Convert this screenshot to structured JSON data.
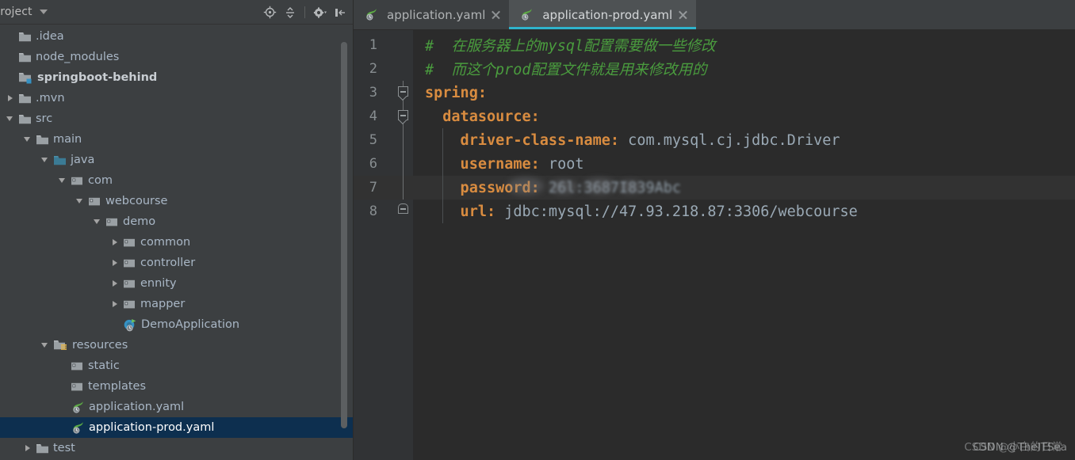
{
  "project_panel": {
    "title": "Project",
    "title_caret_icon": "chevron-down-icon",
    "tools": [
      {
        "name": "locate-in-tree-icon",
        "tooltip": "Select Opened File"
      },
      {
        "name": "collapse-all-icon",
        "tooltip": "Collapse All"
      },
      {
        "name": "settings-gear-icon",
        "tooltip": "Show Options Menu"
      },
      {
        "name": "hide-panel-icon",
        "tooltip": "Hide"
      }
    ],
    "tree": [
      {
        "label": ".idea",
        "indent": 0,
        "twisty": "none",
        "icon": "folder-icon",
        "selected": false,
        "bold": false
      },
      {
        "label": "node_modules",
        "indent": 0,
        "twisty": "none",
        "icon": "folder-icon",
        "selected": false,
        "bold": false
      },
      {
        "label": "springboot-behind",
        "indent": 0,
        "twisty": "none",
        "icon": "module-folder-icon",
        "selected": false,
        "bold": true
      },
      {
        "label": ".mvn",
        "indent": 0,
        "twisty": "collapsed",
        "icon": "folder-icon",
        "selected": false,
        "bold": false
      },
      {
        "label": "src",
        "indent": 0,
        "twisty": "expanded",
        "icon": "folder-icon",
        "selected": false,
        "bold": false
      },
      {
        "label": "main",
        "indent": 1,
        "twisty": "expanded",
        "icon": "folder-icon",
        "selected": false,
        "bold": false
      },
      {
        "label": "java",
        "indent": 2,
        "twisty": "expanded",
        "icon": "source-root-icon",
        "selected": false,
        "bold": false
      },
      {
        "label": "com",
        "indent": 3,
        "twisty": "expanded",
        "icon": "package-icon",
        "selected": false,
        "bold": false
      },
      {
        "label": "webcourse",
        "indent": 4,
        "twisty": "expanded",
        "icon": "package-icon",
        "selected": false,
        "bold": false
      },
      {
        "label": "demo",
        "indent": 5,
        "twisty": "expanded",
        "icon": "package-icon",
        "selected": false,
        "bold": false
      },
      {
        "label": "common",
        "indent": 6,
        "twisty": "collapsed",
        "icon": "package-icon",
        "selected": false,
        "bold": false
      },
      {
        "label": "controller",
        "indent": 6,
        "twisty": "collapsed",
        "icon": "package-icon",
        "selected": false,
        "bold": false
      },
      {
        "label": "ennity",
        "indent": 6,
        "twisty": "collapsed",
        "icon": "package-icon",
        "selected": false,
        "bold": false
      },
      {
        "label": "mapper",
        "indent": 6,
        "twisty": "collapsed",
        "icon": "package-icon",
        "selected": false,
        "bold": false
      },
      {
        "label": "DemoApplication",
        "indent": 6,
        "twisty": "none",
        "icon": "spring-boot-class-icon",
        "selected": false,
        "bold": false
      },
      {
        "label": "resources",
        "indent": 2,
        "twisty": "expanded",
        "icon": "resource-root-icon",
        "selected": false,
        "bold": false
      },
      {
        "label": "static",
        "indent": 3,
        "twisty": "none",
        "icon": "package-icon",
        "selected": false,
        "bold": false
      },
      {
        "label": "templates",
        "indent": 3,
        "twisty": "none",
        "icon": "package-icon",
        "selected": false,
        "bold": false
      },
      {
        "label": "application.yaml",
        "indent": 3,
        "twisty": "none",
        "icon": "spring-yaml-icon",
        "selected": false,
        "bold": false
      },
      {
        "label": "application-prod.yaml",
        "indent": 3,
        "twisty": "none",
        "icon": "spring-yaml-icon",
        "selected": true,
        "bold": false
      },
      {
        "label": "test",
        "indent": 1,
        "twisty": "collapsed",
        "icon": "folder-icon",
        "selected": false,
        "bold": false
      }
    ]
  },
  "editor": {
    "tabs": [
      {
        "label": "application.yaml",
        "icon": "spring-yaml-icon",
        "active": false,
        "close_icon": "close-icon"
      },
      {
        "label": "application-prod.yaml",
        "icon": "spring-yaml-icon",
        "active": true,
        "close_icon": "close-icon"
      }
    ],
    "current_line": 7,
    "lines": [
      {
        "number": "1",
        "fold": "none",
        "tokens": [
          {
            "type": "comment",
            "text": "#  在服务器上的mysql配置需要做一些修改"
          }
        ]
      },
      {
        "number": "2",
        "fold": "none",
        "tokens": [
          {
            "type": "comment",
            "text": "#  而这个prod配置文件就是用来修改用的"
          }
        ]
      },
      {
        "number": "3",
        "fold": "start",
        "tokens": [
          {
            "type": "key",
            "text": "spring"
          },
          {
            "type": "punct",
            "text": ":"
          }
        ]
      },
      {
        "number": "4",
        "fold": "start",
        "tokens": [
          {
            "type": "key",
            "text": "  datasource"
          },
          {
            "type": "punct",
            "text": ":"
          }
        ]
      },
      {
        "number": "5",
        "fold": "body",
        "tokens": [
          {
            "type": "key",
            "text": "    driver-class-name"
          },
          {
            "type": "punct",
            "text": ":"
          },
          {
            "type": "value",
            "text": " com.mysql.cj.jdbc.Driver"
          }
        ]
      },
      {
        "number": "6",
        "fold": "body",
        "tokens": [
          {
            "type": "key",
            "text": "    username"
          },
          {
            "type": "punct",
            "text": ":"
          },
          {
            "type": "value",
            "text": " root"
          }
        ]
      },
      {
        "number": "7",
        "fold": "body",
        "tokens": [
          {
            "type": "key",
            "text": "    password"
          },
          {
            "type": "punct",
            "text": ":"
          },
          {
            "type": "redacted",
            "text": " 26l:3687I839Abc"
          }
        ]
      },
      {
        "number": "8",
        "fold": "end",
        "tokens": [
          {
            "type": "key",
            "text": "    url"
          },
          {
            "type": "punct",
            "text": ":"
          },
          {
            "type": "value",
            "text": " jdbc:mysql://47.93.218.87:3306/webcourse"
          }
        ]
      }
    ]
  },
  "watermark": {
    "text_top": "CSDN @TheITSea",
    "text_bottom": "CSDN @小白的日常"
  },
  "colors": {
    "panel_bg": "#3c3f41",
    "editor_bg": "#2b2b2b",
    "gutter_bg": "#313335",
    "selection_bg": "#0d2f4f",
    "active_tab_bg": "#4e5254",
    "tab_underline": "#2fb3cc",
    "comment": "#4a9c3e",
    "key": "#d98c40",
    "value": "#9aa9b5",
    "text": "#a9b7c6",
    "source_root": "#3b7b95"
  }
}
